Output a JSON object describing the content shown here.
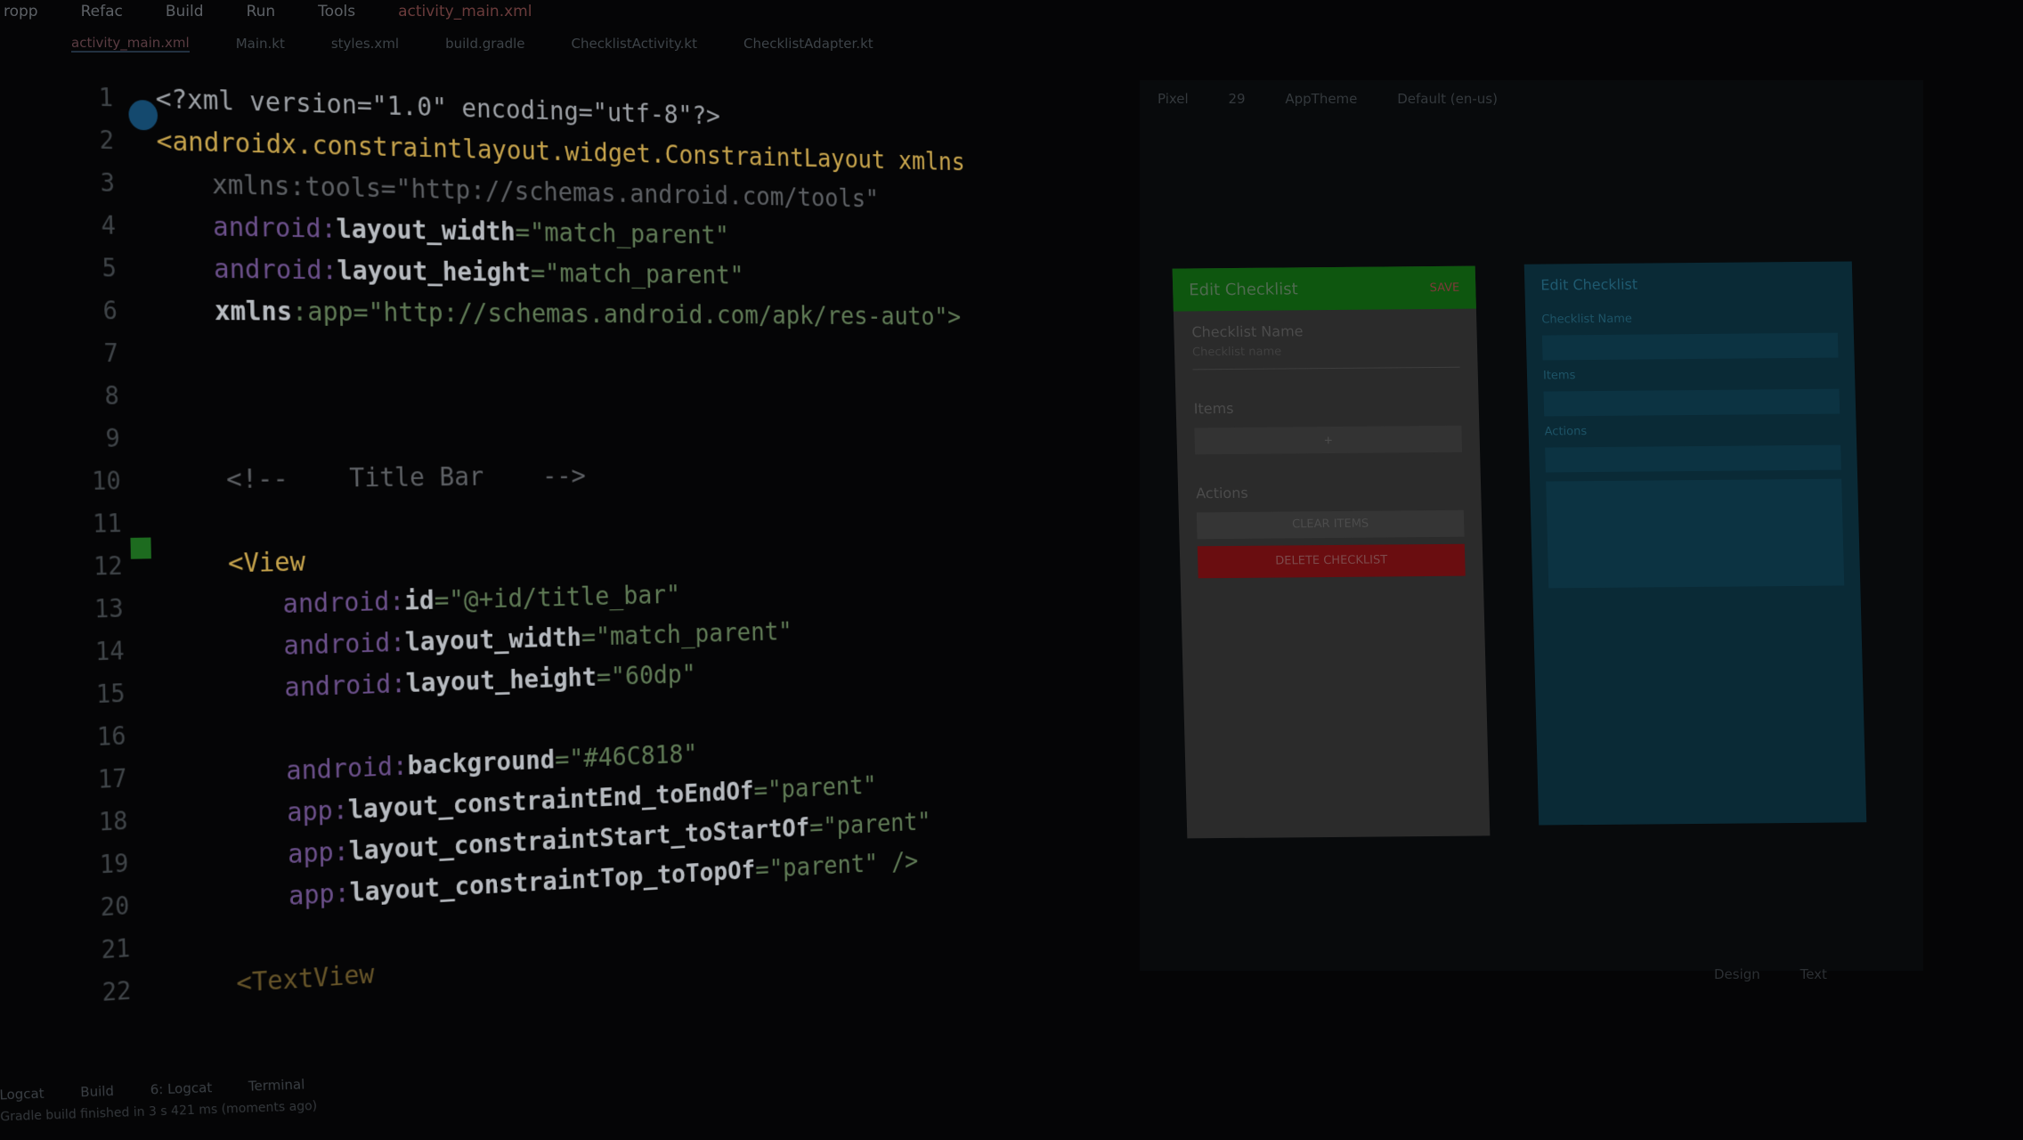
{
  "menubar": {
    "items": [
      "ropp",
      "Refac",
      "Build",
      "Run",
      "Tools"
    ],
    "file_tab": "activity_main.xml"
  },
  "tabs": [
    {
      "label": "activity_main.xml",
      "active": true
    },
    {
      "label": "Main.kt",
      "active": false
    },
    {
      "label": "styles.xml",
      "active": false
    },
    {
      "label": "build.gradle",
      "active": false
    },
    {
      "label": "ChecklistActivity.kt",
      "active": false
    },
    {
      "label": "ChecklistAdapter.kt",
      "active": false
    }
  ],
  "editor": {
    "line_numbers": [
      "1",
      "2",
      "3",
      "4",
      "5",
      "6",
      "7",
      "8",
      "9",
      "10",
      "11",
      "12",
      "13",
      "14",
      "15",
      "16",
      "17",
      "18",
      "19",
      "20",
      "21",
      "22"
    ],
    "lines": {
      "l1": "<?xml version=\"1.0\" encoding=\"utf-8\"?>",
      "l2_tag": "<androidx.constraintlayout.widget.ConstraintLayout xmlns",
      "l3": "xmlns:tools=\"http://schemas.android.com/tools\"",
      "l4_ns": "android:",
      "l4_attr": "layout_width",
      "l4_val": "=\"match_parent\"",
      "l5_ns": "android:",
      "l5_attr": "layout_height",
      "l5_val": "=\"match_parent\"",
      "l6_attr": "xmlns",
      "l6_val": ":app=\"http://schemas.android.com/apk/res-auto\">",
      "l10": "<!--    Title Bar    -->",
      "l12": "<View",
      "l13_ns": "android:",
      "l13_attr": "id",
      "l13_val": "=\"@+id/title_bar\"",
      "l14_ns": "android:",
      "l14_attr": "layout_width",
      "l14_val": "=\"match_parent\"",
      "l15_ns": "android:",
      "l15_attr": "layout_height",
      "l15_val": "=\"60dp\"",
      "l17_ns": "android:",
      "l17_attr": "background",
      "l17_val": "=\"#46C818\"",
      "l18_ns": "app:",
      "l18_attr": "layout_constraintEnd_toEndOf",
      "l18_val": "=\"parent\"",
      "l19_ns": "app:",
      "l19_attr": "layout_constraintStart_toStartOf",
      "l19_val": "=\"parent\"",
      "l20_ns": "app:",
      "l20_attr": "layout_constraintTop_toTopOf",
      "l20_val": "=\"parent\" />",
      "l23": "<TextView"
    }
  },
  "preview": {
    "toolbar": [
      "Pixel",
      "29",
      "AppTheme",
      "Default (en-us)"
    ],
    "phone": {
      "title": "Edit Checklist",
      "save_label": "SAVE",
      "name_label": "Checklist Name",
      "name_value": "Checklist name",
      "items_label": "Items",
      "items_value": "+",
      "actions_label": "Actions",
      "clear_button": "CLEAR ITEMS",
      "delete_button": "DELETE CHECKLIST"
    },
    "blueprint": {
      "title": "Edit Checklist",
      "labels": [
        "Checklist Name",
        "Items",
        "Actions"
      ]
    },
    "bottom": [
      "Design",
      "Text"
    ]
  },
  "statusbar": {
    "items": [
      "Logcat",
      "Build",
      "6: Logcat",
      "Terminal"
    ],
    "message": "Gradle build finished in 3 s 421 ms (moments ago)"
  },
  "colors": {
    "background": "#050506",
    "tag": "#c5a24b",
    "string": "#5f7a55",
    "phone_bar": "#0e560f",
    "delete_btn": "#6a0d10",
    "blueprint": "#0a2a36"
  }
}
